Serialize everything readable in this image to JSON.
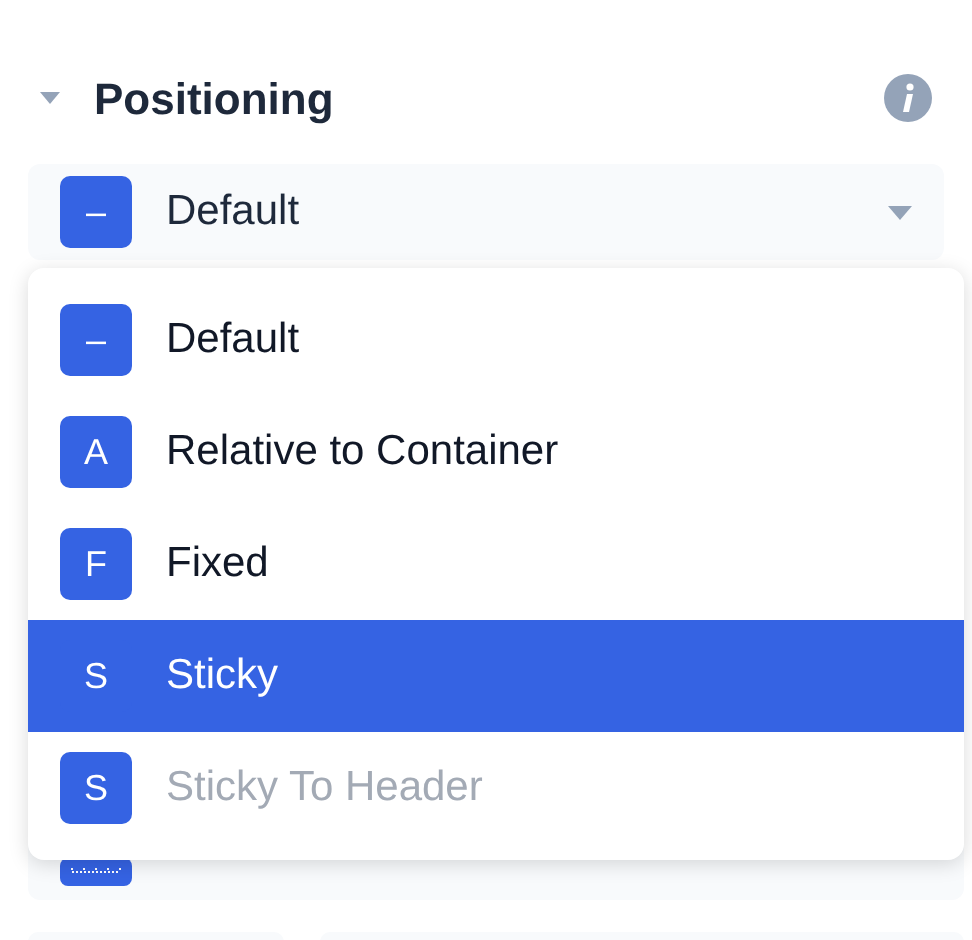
{
  "section": {
    "title": "Positioning",
    "expanded": true
  },
  "select": {
    "value": "Default",
    "icon": "–"
  },
  "menu": {
    "options": [
      {
        "icon": "–",
        "label": "Default",
        "selected": false,
        "disabled": false
      },
      {
        "icon": "A",
        "label": "Relative to Container",
        "selected": false,
        "disabled": false
      },
      {
        "icon": "F",
        "label": "Fixed",
        "selected": false,
        "disabled": false
      },
      {
        "icon": "S",
        "label": "Sticky",
        "selected": true,
        "disabled": false
      },
      {
        "icon": "S",
        "label": "Sticky To Header",
        "selected": false,
        "disabled": true
      }
    ]
  }
}
